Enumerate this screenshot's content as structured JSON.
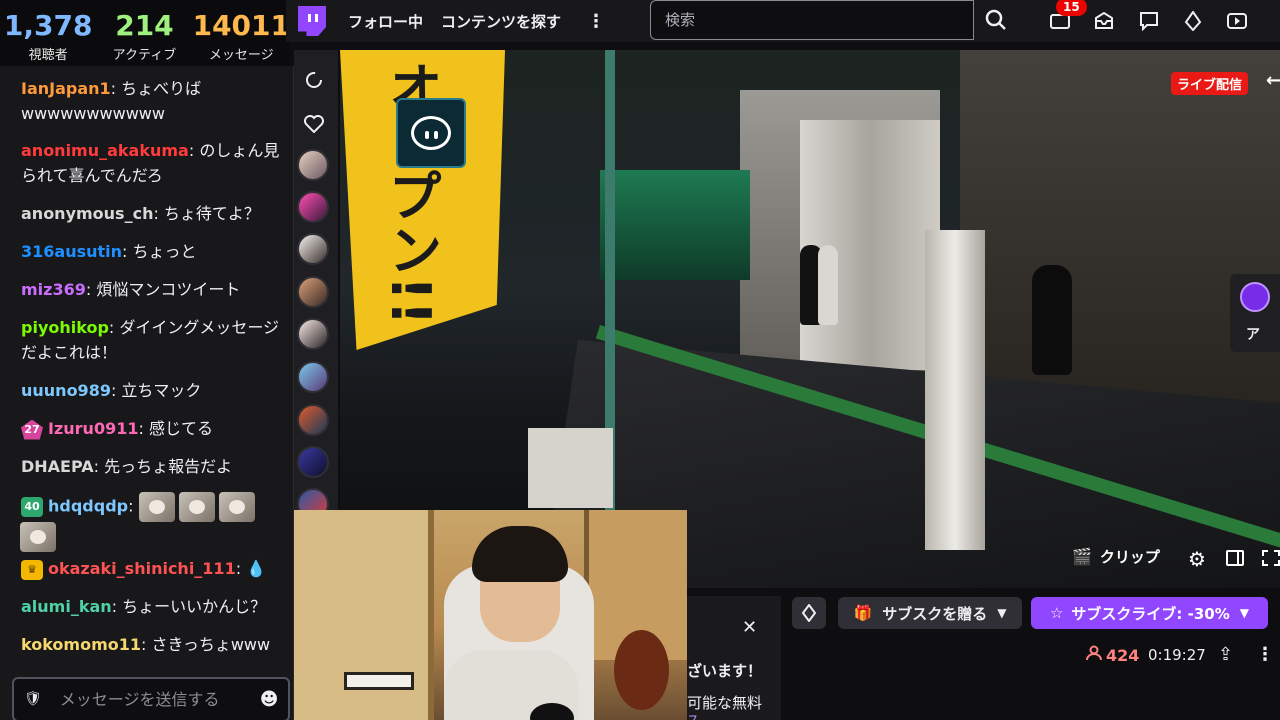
{
  "stats": {
    "viewers": {
      "value": "1,378",
      "label": "視聴者"
    },
    "active": {
      "value": "214",
      "label": "アクティブ"
    },
    "messages": {
      "value": "14011",
      "label": "メッセージ"
    }
  },
  "nav": {
    "following": "フォロー中",
    "browse": "コンテンツを探す",
    "more": "⋮",
    "search_placeholder": "検索",
    "notification_count": "15"
  },
  "chat": {
    "messages": [
      {
        "user": "IanJapan1",
        "color": "#ff9a3c",
        "text": ": ちょべりばwwwwwwwwwww"
      },
      {
        "user": "anonimu_akakuma",
        "color": "#ff3b3b",
        "text": ": のしょん見られて喜んでんだろ"
      },
      {
        "user": "anonymous_ch",
        "color": "#d8d8d8",
        "text": ": ちょ待てよ？"
      },
      {
        "user": "316ausutin",
        "color": "#1e90ff",
        "text": ": ちょっと"
      },
      {
        "user": "miz369",
        "color": "#c96dff",
        "text": ": 煩悩マンコツイート"
      },
      {
        "user": "piyohikop",
        "color": "#7cfc00",
        "text": ": ダイイングメッセージだよこれは！"
      },
      {
        "user": "uuuno989",
        "color": "#7ec8ff",
        "text": ": 立ちマック"
      },
      {
        "user": "Izuru0911",
        "color": "#ff69b4",
        "badge": "27",
        "text": ": 感じてる"
      },
      {
        "user": "DHAEPA",
        "color": "#d8d8d8",
        "text": ": 先っちょ報告だよ"
      },
      {
        "user": "hdqdqdp",
        "color": "#7ec8ff",
        "badge": "40",
        "text": ":"
      },
      {
        "user": "okazaki_shinichi_111",
        "color": "#ff5252",
        "badge": "♛",
        "text": ":"
      },
      {
        "user": "alumi_kan",
        "color": "#4fd1a5",
        "text": ": ちょーいいかんじ？"
      },
      {
        "user": "kokomomo11",
        "color": "#f5d76e",
        "text": ": さきっちょwww"
      }
    ],
    "input_placeholder": "メッセージを送信する"
  },
  "player": {
    "live_badge": "ライブ配信",
    "clip_label": "クリップ",
    "banner_text": "オープン!!",
    "side_ext_text": "ア"
  },
  "below": {
    "gift_sub": "サブスクを贈る",
    "subscribe": "サブスクライブ: -30%",
    "viewer_count": "424",
    "uptime": "0:19:27",
    "notice_close": "✕",
    "notice_line1": "ざいます！",
    "notice_line2": "可能な無料",
    "notice_line3": "ス"
  }
}
